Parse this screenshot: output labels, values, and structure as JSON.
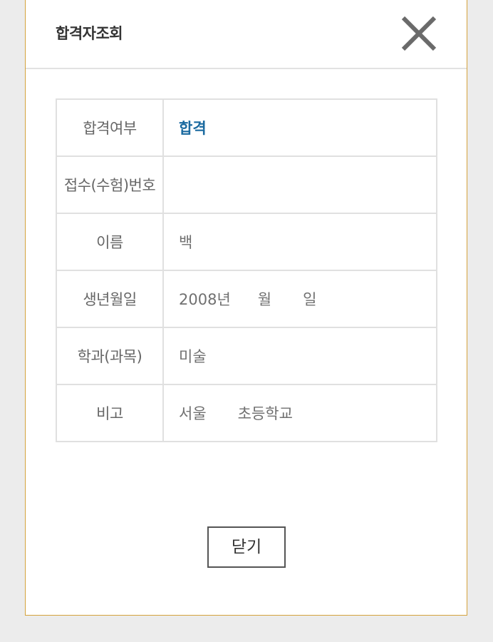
{
  "modal": {
    "title": "합격자조회",
    "close_icon": "close-icon"
  },
  "table": {
    "rows": [
      {
        "label": "합격여부",
        "value": "합격"
      },
      {
        "label": "접수(수험)번호",
        "value": ""
      },
      {
        "label": "이름",
        "value": "백"
      },
      {
        "label": "생년월일",
        "year": "2008년",
        "month": "월",
        "day": "일"
      },
      {
        "label": "학과(과목)",
        "value": "미술"
      },
      {
        "label": "비고",
        "city": "서울",
        "school": "초등학교"
      }
    ]
  },
  "footer": {
    "close_label": "닫기"
  },
  "colors": {
    "border_accent": "#d4a23c",
    "pass_text": "#1b6aa0"
  }
}
